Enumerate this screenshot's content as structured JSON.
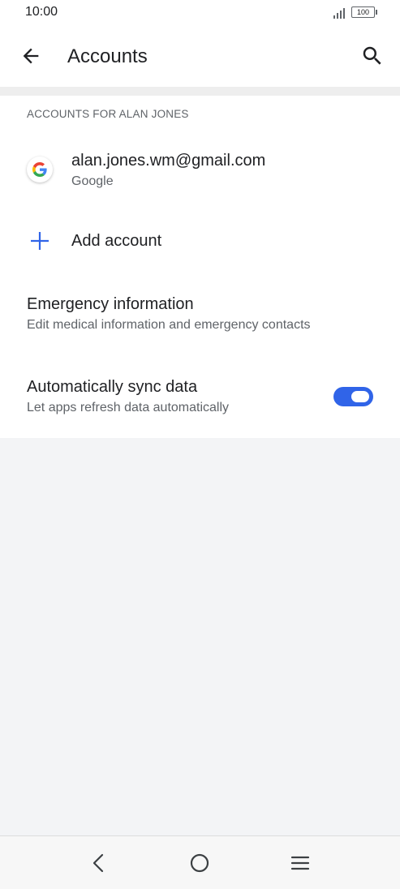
{
  "status_bar": {
    "time": "10:00",
    "battery": "100"
  },
  "app_bar": {
    "title": "Accounts",
    "back_icon": "arrow-left-icon",
    "search_icon": "search-icon"
  },
  "section": {
    "header": "ACCOUNTS FOR ALAN JONES"
  },
  "account": {
    "email": "alan.jones.wm@gmail.com",
    "type": "Google",
    "icon": "google-icon"
  },
  "add_account": {
    "label": "Add account",
    "icon": "plus-icon"
  },
  "emergency": {
    "title": "Emergency information",
    "subtitle": "Edit medical information and emergency contacts"
  },
  "sync": {
    "title": "Automatically sync data",
    "subtitle": "Let apps refresh data automatically",
    "enabled": true
  },
  "nav": {
    "back_icon": "nav-back-icon",
    "home_icon": "nav-home-icon",
    "menu_icon": "nav-menu-icon"
  },
  "colors": {
    "accent": "#3064e8",
    "primary_text": "#202124",
    "secondary_text": "#5f6368",
    "background": "#f3f4f6"
  }
}
